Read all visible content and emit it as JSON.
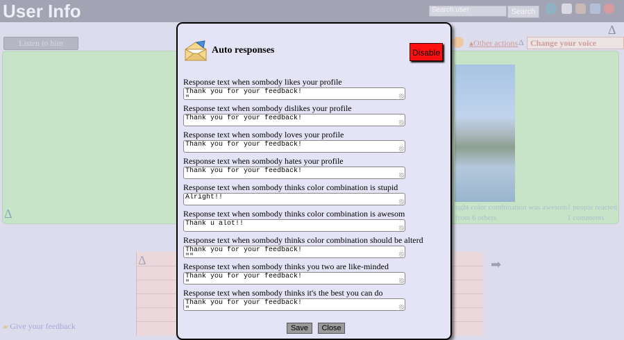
{
  "header": {
    "title": "User Info",
    "search_placeholder": "Search user",
    "search_button": "Search",
    "icons": [
      "users-icon",
      "home-icon",
      "settings-icon",
      "picture-icon",
      "logout-icon"
    ]
  },
  "background": {
    "listen_button": "Listen to him",
    "other_actions": "Other actions",
    "change_voice": "Change your voice sample",
    "reaction_text": "ught color combination was awesom",
    "reaction_count": "1 people reacted",
    "from_others": "from 6 others",
    "comments": "1 comments",
    "feedback_link": "Give your feedback"
  },
  "modal": {
    "title": "Auto responses",
    "disable_button": "Disable",
    "save_button": "Save",
    "close_button": "Close",
    "rows": [
      {
        "label": "Response text when sombody likes your profile",
        "value": "Thank you for your feedback!\n\""
      },
      {
        "label": "Response text when sombody dislikes your profile",
        "value": "Thank you for your feedback!"
      },
      {
        "label": "Response text when sombody loves your profile",
        "value": "Thank you for your feedback!"
      },
      {
        "label": "Response text when sombody hates your profile",
        "value": "Thank you for your feedback!"
      },
      {
        "label": "Response text when sombody thinks color combination is stupid",
        "value": "Alright!!"
      },
      {
        "label": "Response text when sombody thinks color combination is awesom",
        "value": "Thank u alot!!"
      },
      {
        "label": "Response text when sombody thinks color combination should be alterd",
        "value": "Thank you for your feedback!\n\"\""
      },
      {
        "label": "Response text when sombody thinks you two are like-minded",
        "value": "Thank you for your feedback!\n\""
      },
      {
        "label": "Response text when sombody thinks it's the best you can do",
        "value": "Thank you for your feedback!\n\""
      }
    ]
  },
  "colors": {
    "header_bg": "#a3a3b4",
    "modal_bg": "#e4e4f6",
    "disable_red": "#ff1010",
    "green_panel": "#c8e4c8"
  }
}
